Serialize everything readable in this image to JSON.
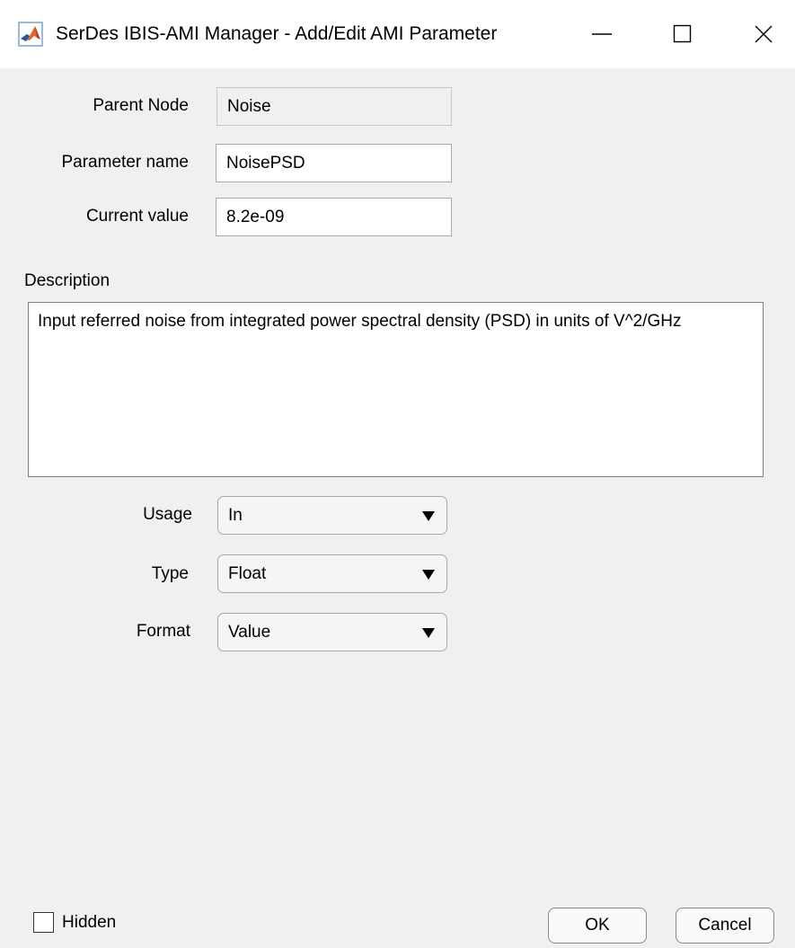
{
  "window": {
    "title": "SerDes IBIS-AMI Manager - Add/Edit AMI Parameter",
    "app_icon": "matlab-icon",
    "controls": [
      "minimize-icon",
      "maximize-icon",
      "close-icon"
    ]
  },
  "form": {
    "parent_node": {
      "label": "Parent Node",
      "value": "Noise"
    },
    "parameter_name": {
      "label": "Parameter name",
      "value": "NoisePSD"
    },
    "current_value": {
      "label": "Current value",
      "value": "8.2e-09"
    },
    "description": {
      "label": "Description",
      "value": "Input referred noise from integrated power spectral density (PSD) in units of V^2/GHz"
    },
    "usage": {
      "label": "Usage",
      "selected": "In"
    },
    "type": {
      "label": "Type",
      "selected": "Float"
    },
    "format": {
      "label": "Format",
      "selected": "Value"
    }
  },
  "footer": {
    "hidden_label": "Hidden",
    "hidden_checked": false,
    "ok_label": "OK",
    "cancel_label": "Cancel"
  }
}
